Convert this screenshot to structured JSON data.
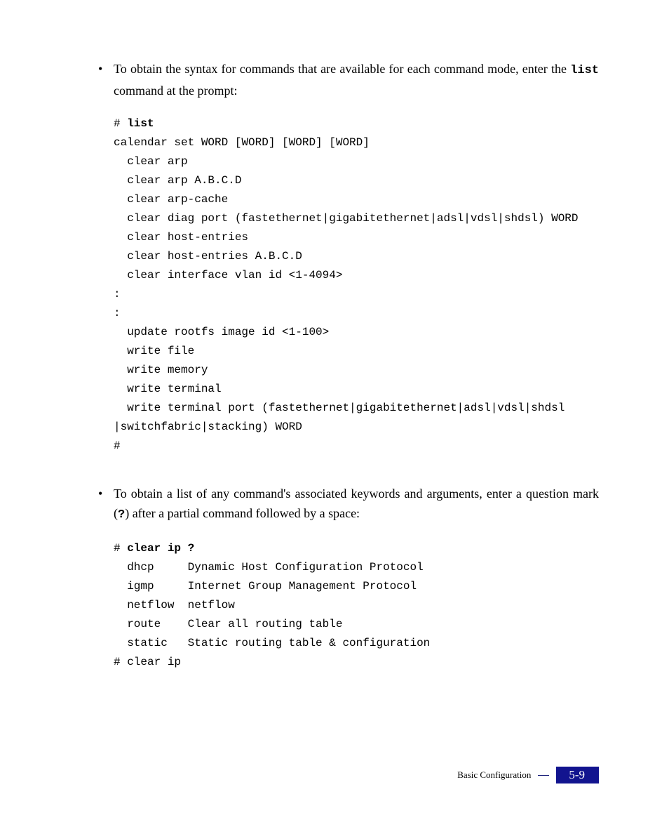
{
  "bullets": [
    {
      "pre": "To obtain the syntax for commands that are available for each command mode, enter the ",
      "cmd": "list",
      "post": " command at the prompt:"
    },
    {
      "pre": "To obtain a list of any command's associated keywords and arguments, enter a question mark (",
      "cmd": "?",
      "post": ") after a partial command followed by a space:"
    }
  ],
  "code1": {
    "prompt": "# ",
    "cmd": "list",
    "body": "calendar set WORD [WORD] [WORD] [WORD]\n  clear arp\n  clear arp A.B.C.D\n  clear arp-cache\n  clear diag port (fastethernet|gigabitethernet|adsl|vdsl|shdsl) WORD\n  clear host-entries\n  clear host-entries A.B.C.D\n  clear interface vlan id <1-4094>\n:\n:\n  update rootfs image id <1-100>\n  write file\n  write memory\n  write terminal\n  write terminal port (fastethernet|gigabitethernet|adsl|vdsl|shdsl\n|switchfabric|stacking) WORD\n#"
  },
  "code2": {
    "prompt": "# ",
    "cmd": "clear ip ?",
    "body": "  dhcp     Dynamic Host Configuration Protocol\n  igmp     Internet Group Management Protocol\n  netflow  netflow\n  route    Clear all routing table\n  static   Static routing table & configuration\n# clear ip"
  },
  "footer": {
    "label": "Basic Configuration",
    "page": "5-9"
  }
}
